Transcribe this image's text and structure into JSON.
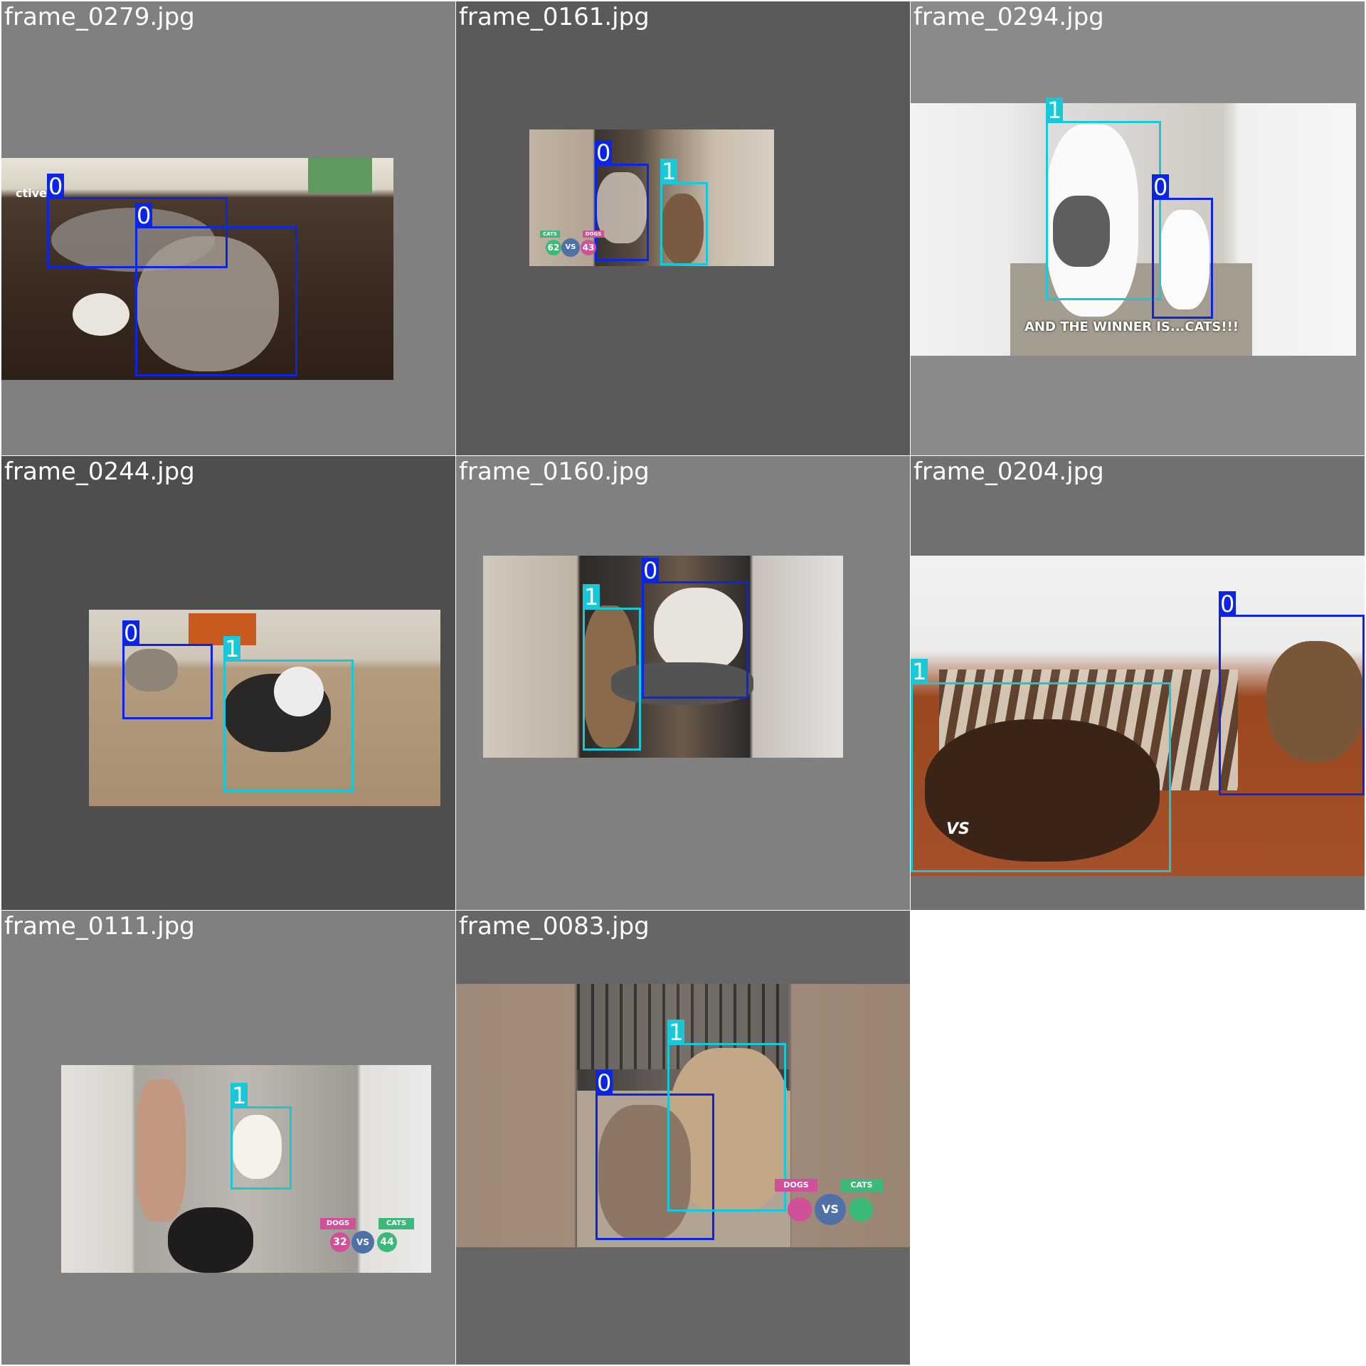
{
  "colors": {
    "class_0": "#0a25e6",
    "class_1": "#19c8d8",
    "cats_badge": "#3cb878",
    "dogs_badge": "#d0509a",
    "vs_badge": "#5070a8"
  },
  "tiles": [
    {
      "title": "frame_0279.jpg",
      "boxes": [
        {
          "label": "0"
        },
        {
          "label": "0"
        }
      ],
      "overlay": "ctive"
    },
    {
      "title": "frame_0161.jpg",
      "boxes": [
        {
          "label": "0"
        },
        {
          "label": "1"
        }
      ],
      "scoreboard": {
        "cats": "CATS",
        "dogs": "DOGS",
        "cats_score": "62",
        "vs": "VS",
        "dogs_score": "43"
      }
    },
    {
      "title": "frame_0294.jpg",
      "boxes": [
        {
          "label": "1"
        },
        {
          "label": "0"
        }
      ],
      "caption": "AND THE WINNER IS...CATS!!!"
    },
    {
      "title": "frame_0244.jpg",
      "boxes": [
        {
          "label": "0"
        },
        {
          "label": "1"
        }
      ]
    },
    {
      "title": "frame_0160.jpg",
      "boxes": [
        {
          "label": "1"
        },
        {
          "label": "0"
        }
      ]
    },
    {
      "title": "frame_0204.jpg",
      "boxes": [
        {
          "label": "0"
        },
        {
          "label": "1"
        }
      ],
      "overlay": "VS"
    },
    {
      "title": "frame_0111.jpg",
      "boxes": [
        {
          "label": "1"
        }
      ],
      "scoreboard": {
        "cats": "CATS",
        "dogs": "DOGS",
        "cats_score": "44",
        "vs": "VS",
        "dogs_score": "32"
      }
    },
    {
      "title": "frame_0083.jpg",
      "boxes": [
        {
          "label": "0"
        },
        {
          "label": "1"
        }
      ],
      "scoreboard": {
        "cats": "CATS",
        "dogs": "DOGS",
        "vs": "VS"
      }
    }
  ]
}
